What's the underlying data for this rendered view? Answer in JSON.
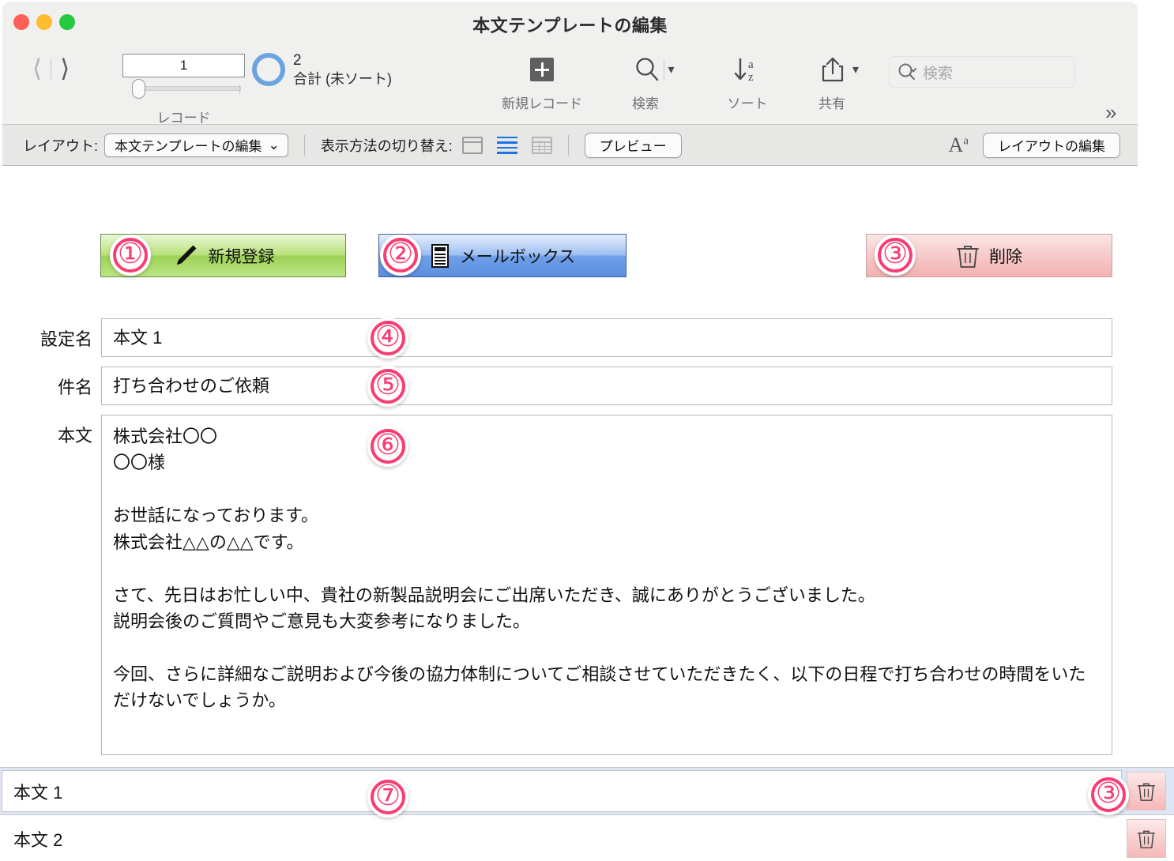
{
  "window": {
    "title": "本文テンプレートの編集",
    "traffic_lights": [
      "close",
      "minimize",
      "zoom"
    ]
  },
  "toolbar": {
    "record_number": "1",
    "record_caption": "レコード",
    "total_count": "2",
    "total_label": "合計 (未ソート)",
    "buttons": [
      {
        "icon": "plus-icon",
        "label": "新規レコード"
      },
      {
        "icon": "search-icon",
        "label": "検索",
        "has_caret": true
      },
      {
        "icon": "sort-az-icon",
        "label": "ソート"
      },
      {
        "icon": "share-icon",
        "label": "共有",
        "has_caret": true
      }
    ],
    "search_placeholder": "検索",
    "overflow_icon": "chevron-double-right-icon"
  },
  "layout_bar": {
    "layout_label": "レイアウト:",
    "layout_value": "本文テンプレートの編集",
    "view_switch_label": "表示方法の切り替え:",
    "view_modes": [
      "form-view-icon",
      "list-view-icon",
      "table-view-icon"
    ],
    "active_view": "list-view-icon",
    "preview_label": "プレビュー",
    "text_size_icon": "text-size-icon",
    "edit_layout_label": "レイアウトの編集"
  },
  "action_buttons": [
    {
      "badge": "①",
      "icon": "pencil-icon",
      "label": "新規登録",
      "color": "#9ed257"
    },
    {
      "badge": "②",
      "icon": "mailbox-icon",
      "label": "メールボックス",
      "color": "#6f9fe8"
    },
    {
      "badge": "③",
      "icon": "trash-icon",
      "label": "削除",
      "color": "#f3b1b1"
    }
  ],
  "form": {
    "fields": [
      {
        "badge": "④",
        "label": "設定名",
        "value": "本文 1"
      },
      {
        "badge": "⑤",
        "label": "件名",
        "value": "打ち合わせのご依頼"
      }
    ],
    "body": {
      "badge": "⑥",
      "label": "本文",
      "value": "株式会社〇〇\n〇〇様\n\nお世話になっております。\n株式会社△△の△△です。\n\nさて、先日はお忙しい中、貴社の新製品説明会にご出席いただき、誠にありがとうございました。\n説明会後のご質問やご意見も大変参考になりました。\n\n今回、さらに詳細なご説明および今後の協力体制についてご相談させていただきたく、以下の日程で打ち合わせの時間をいただけないでしょうか。"
    }
  },
  "list": {
    "badge_row": "⑦",
    "badge_trash": "③",
    "rows": [
      {
        "name": "本文 1",
        "selected": true,
        "action_icon": "trash-icon"
      },
      {
        "name": "本文 2",
        "selected": false,
        "action_icon": "trash-icon"
      }
    ]
  },
  "colors": {
    "badge_pink": "#fa3c73",
    "selection_blue": "#dde6f4",
    "accent_blue": "#1a73e8"
  }
}
